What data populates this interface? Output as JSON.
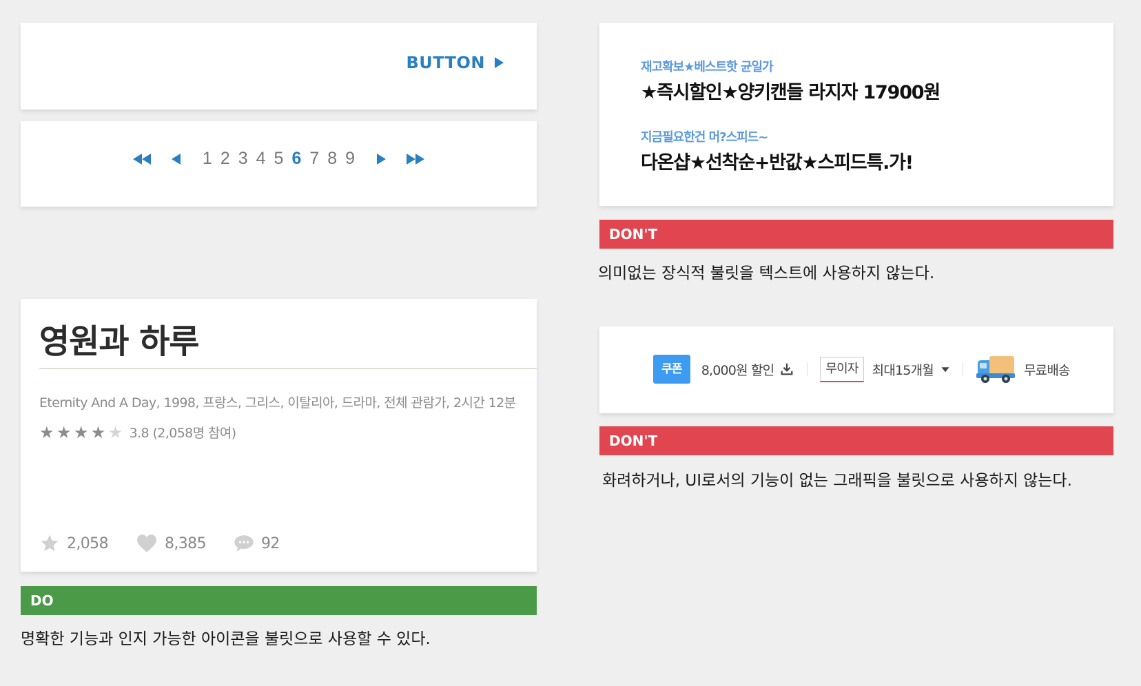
{
  "button_example": {
    "label": "BUTTON"
  },
  "pagination": {
    "pages": [
      "1",
      "2",
      "3",
      "4",
      "5",
      "6",
      "7",
      "8",
      "9"
    ],
    "active": "6"
  },
  "movie": {
    "title": "영원과 하루",
    "meta": "Eternity And A Day, 1998, 프랑스, 그리스, 이탈리아, 드라마, 전체 관람가, 2시간 12분",
    "rating_text": "3.8 (2,058명 참여)",
    "stars_filled": 4,
    "stars_total": 5,
    "stats": {
      "stars": "2,058",
      "likes": "8,385",
      "comments": "92"
    }
  },
  "promo": {
    "line1_sub": "재고확보★베스트핫 균일가",
    "line1_main": "★즉시할인★양키캔들 라지자 17900원",
    "line2_sub": "지금필요한건 머?스피드~",
    "line2_main": "다온샵★선착순+반값★스피드특.가!"
  },
  "benefits": {
    "coupon_badge": "쿠폰",
    "coupon_text": "8,000원 할인",
    "no_interest_badge": "무이자",
    "no_interest_text": "최대15개월",
    "delivery_text": "무료배송"
  },
  "labels": {
    "do": "DO",
    "dont_1": "DON'T",
    "dont_2": "DON'T"
  },
  "captions": {
    "do": "명확한 기능과 인지 가능한 아이콘을 불릿으로 사용할 수 있다.",
    "dont_1": "의미없는 장식적 불릿을 텍스트에 사용하지 않는다.",
    "dont_2": "화려하거나, UI로서의 기능이 없는 그래픽을 불릿으로 사용하지 않는다."
  },
  "colors": {
    "accent_blue": "#2a7fc0",
    "dont_red": "#e04550",
    "do_green": "#4a9a47",
    "coupon_blue": "#3d9bf0"
  }
}
